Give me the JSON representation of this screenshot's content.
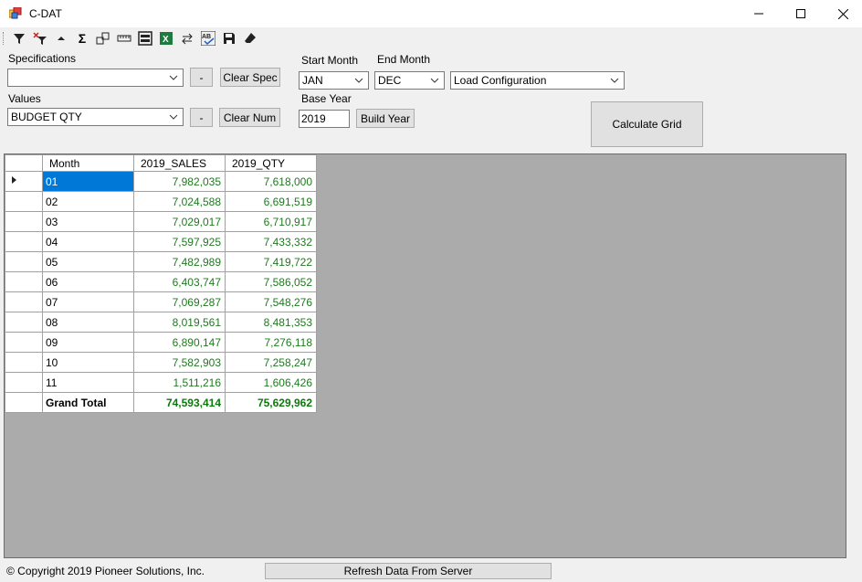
{
  "window": {
    "title": "C-DAT"
  },
  "toolbar": {
    "buttons": [
      {
        "icon": "filter-icon"
      },
      {
        "icon": "clear-filter-icon"
      },
      {
        "icon": "sort-up-icon"
      },
      {
        "icon": "sum-icon"
      },
      {
        "icon": "columns-icon"
      },
      {
        "icon": "ruler-icon"
      },
      {
        "icon": "layout-icon"
      },
      {
        "icon": "excel-icon"
      },
      {
        "icon": "swap-icon"
      },
      {
        "icon": "spellcheck-icon"
      },
      {
        "icon": "save-icon"
      },
      {
        "icon": "eraser-icon"
      }
    ]
  },
  "form": {
    "specifications_label": "Specifications",
    "specifications_value": "",
    "spec_minus": "-",
    "clear_spec": "Clear Spec",
    "values_label": "Values",
    "values_value": "BUDGET QTY",
    "values_minus": "-",
    "clear_num": "Clear Num",
    "start_month_label": "Start Month",
    "start_month_value": "JAN",
    "end_month_label": "End Month",
    "end_month_value": "DEC",
    "load_config_value": "Load Configuration",
    "base_year_label": "Base Year",
    "base_year_value": "2019",
    "build_year": "Build Year",
    "calculate_grid": "Calculate Grid"
  },
  "grid": {
    "columns": [
      "Month",
      "2019_SALES",
      "2019_QTY"
    ],
    "rows": [
      {
        "month": "01",
        "sales": "7,982,035",
        "qty": "7,618,000"
      },
      {
        "month": "02",
        "sales": "7,024,588",
        "qty": "6,691,519"
      },
      {
        "month": "03",
        "sales": "7,029,017",
        "qty": "6,710,917"
      },
      {
        "month": "04",
        "sales": "7,597,925",
        "qty": "7,433,332"
      },
      {
        "month": "05",
        "sales": "7,482,989",
        "qty": "7,419,722"
      },
      {
        "month": "06",
        "sales": "6,403,747",
        "qty": "7,586,052"
      },
      {
        "month": "07",
        "sales": "7,069,287",
        "qty": "7,548,276"
      },
      {
        "month": "08",
        "sales": "8,019,561",
        "qty": "8,481,353"
      },
      {
        "month": "09",
        "sales": "6,890,147",
        "qty": "7,276,118"
      },
      {
        "month": "10",
        "sales": "7,582,903",
        "qty": "7,258,247"
      },
      {
        "month": "11",
        "sales": "1,511,216",
        "qty": "1,606,426"
      }
    ],
    "total": {
      "month": "Grand Total",
      "sales": "74,593,414",
      "qty": "75,629,962"
    }
  },
  "footer": {
    "copyright": "© Copyright 2019 Pioneer Solutions, Inc.",
    "refresh": "Refresh Data From Server"
  }
}
